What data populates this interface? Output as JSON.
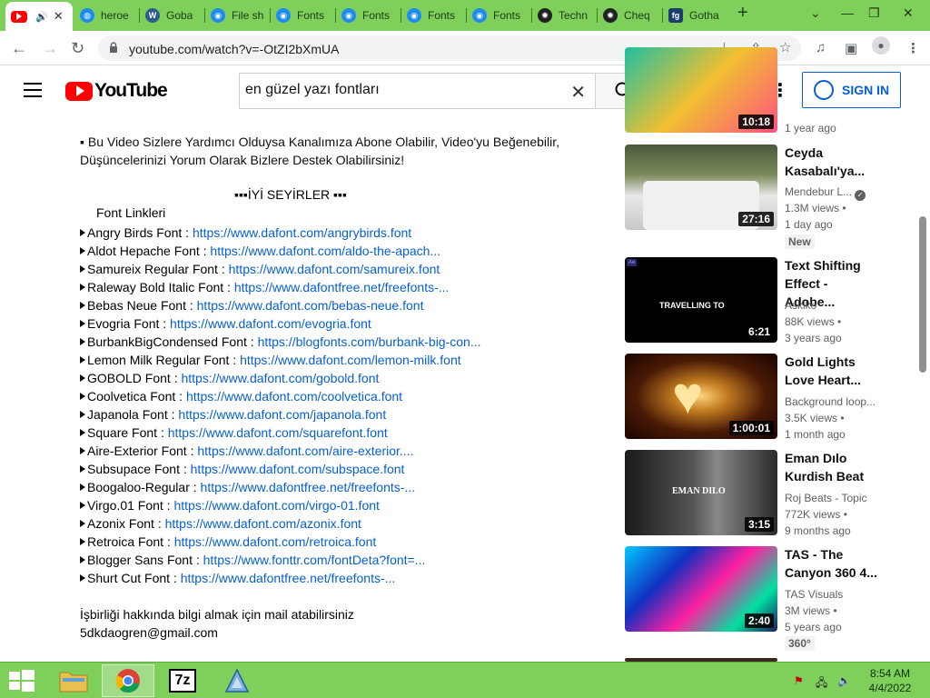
{
  "browser": {
    "tabs": [
      {
        "label": "",
        "icon": "youtube-favicon",
        "active": true
      },
      {
        "label": "heroe",
        "icon": "globe-favicon"
      },
      {
        "label": "Goba",
        "icon": "wordpress-favicon"
      },
      {
        "label": "File sh",
        "icon": "eye-favicon"
      },
      {
        "label": "Fonts",
        "icon": "eye-favicon"
      },
      {
        "label": "Fonts",
        "icon": "eye-favicon"
      },
      {
        "label": "Fonts",
        "icon": "eye-favicon"
      },
      {
        "label": "Fonts",
        "icon": "eye-favicon"
      },
      {
        "label": "Techn",
        "icon": "chatgpt-favicon"
      },
      {
        "label": "Cheq",
        "icon": "chatgpt-favicon"
      },
      {
        "label": "Gotha",
        "icon": "fg-favicon",
        "icon_text": "fg"
      }
    ],
    "url": "youtube.com/watch?v=-OtZI2bXmUA"
  },
  "youtube": {
    "logo_text": "YouTube",
    "search_query": "en güzel yazı fontları",
    "sign_in_label": "SIGN IN"
  },
  "description": {
    "intro": "▪ Bu Video Sizlere Yardımcı Olduysa Kanalımıza Abone Olabilir, Video'yu Beğenebilir, Düşüncelerinizi Yorum Olarak Bizlere Destek Olabilirsiniz!",
    "enjoy": "▪▪▪İYİ SEYİRLER ▪▪▪",
    "font_links_heading": "Font Linkleri",
    "fonts": [
      {
        "name": "Angry Birds Font : ",
        "link": "https://www.dafont.com/angrybirds.font"
      },
      {
        "name": "Aldot Hepache Font : ",
        "link": "https://www.dafont.com/aldo-the-apach..."
      },
      {
        "name": "Samureix Regular Font : ",
        "link": "https://www.dafont.com/samureix.font"
      },
      {
        "name": "Raleway Bold Italic Font : ",
        "link": "https://www.dafontfree.net/freefonts-..."
      },
      {
        "name": "Bebas Neue Font : ",
        "link": "https://www.dafont.com/bebas-neue.font"
      },
      {
        "name": "Evogria Font : ",
        "link": "https://www.dafont.com/evogria.font"
      },
      {
        "name": "BurbankBigCondensed Font : ",
        "link": "https://blogfonts.com/burbank-big-con..."
      },
      {
        "name": "Lemon Milk Regular Font : ",
        "link": "https://www.dafont.com/lemon-milk.font"
      },
      {
        "name": "GOBOLD Font : ",
        "link": "https://www.dafont.com/gobold.font"
      },
      {
        "name": "Coolvetica Font : ",
        "link": "https://www.dafont.com/coolvetica.font"
      },
      {
        "name": "Japanola Font : ",
        "link": "https://www.dafont.com/japanola.font"
      },
      {
        "name": "Square Font : ",
        "link": "https://www.dafont.com/squarefont.font"
      },
      {
        "name": "Aire-Exterior Font : ",
        "link": "https://www.dafont.com/aire-exterior...."
      },
      {
        "name": "Subsupace Font : ",
        "link": "https://www.dafont.com/subspace.font"
      },
      {
        "name": "Boogaloo-Regular : ",
        "link": "https://www.dafontfree.net/freefonts-..."
      },
      {
        "name": "Virgo.01 Font : ",
        "link": "https://www.dafont.com/virgo-01.font"
      },
      {
        "name": "Azonix Font : ",
        "link": "https://www.dafont.com/azonix.font"
      },
      {
        "name": "Retroica Font : ",
        "link": "https://www.dafont.com/retroica.font"
      },
      {
        "name": "Blogger Sans Font : ",
        "link": "https://www.fonttr.com/fontDeta?font=..."
      },
      {
        "name": "Shurt Cut Font : ",
        "link": "https://www.dafontfree.net/freefonts-..."
      }
    ],
    "contact_line": "İşbirliği hakkında bilgi almak için mail atabilirsiniz",
    "email": "5dkdaogren@gmail.com"
  },
  "sidebar": {
    "partial_top": {
      "meta": "1 year ago",
      "duration": "10:18"
    },
    "videos": [
      {
        "title": "Ceyda Kasabalı'ya...",
        "channel": "Mendebur L...",
        "verified": true,
        "views": "1.3M views •",
        "age": "1 day ago",
        "badge": "New",
        "duration": "27:16",
        "thumb_text": ""
      },
      {
        "title": "Text Shifting Effect - Adobe...",
        "channel": "Askiko",
        "views": "88K views •",
        "age": "3 years ago",
        "badge": "",
        "duration": "6:21",
        "thumb_text": "TRAVELLING TO"
      },
      {
        "title": "Gold Lights Love Heart...",
        "channel": "Background loop...",
        "views": "3.5K views •",
        "age": "1 month ago",
        "badge": "",
        "duration": "1:00:01",
        "thumb_text": ""
      },
      {
        "title": "Eman Dılo Kurdish Beat",
        "channel": "Roj Beats - Topic",
        "views": "772K views •",
        "age": "9 months ago",
        "badge": "",
        "duration": "3:15",
        "thumb_text": "EMAN DILO"
      },
      {
        "title": "TAS - The Canyon 360 4...",
        "channel": "TAS Visuals",
        "views": "3M views •",
        "age": "5 years ago",
        "badge": "360°",
        "duration": "2:40",
        "thumb_text": ""
      }
    ]
  },
  "taskbar": {
    "time": "8:54 AM",
    "date": "4/4/2022",
    "apps": [
      "file-explorer",
      "chrome",
      "7zip",
      "app-icon"
    ]
  },
  "colors": {
    "accent_green": "#7fcf5b",
    "link_blue": "#065fd4",
    "youtube_red": "#ff0000"
  }
}
